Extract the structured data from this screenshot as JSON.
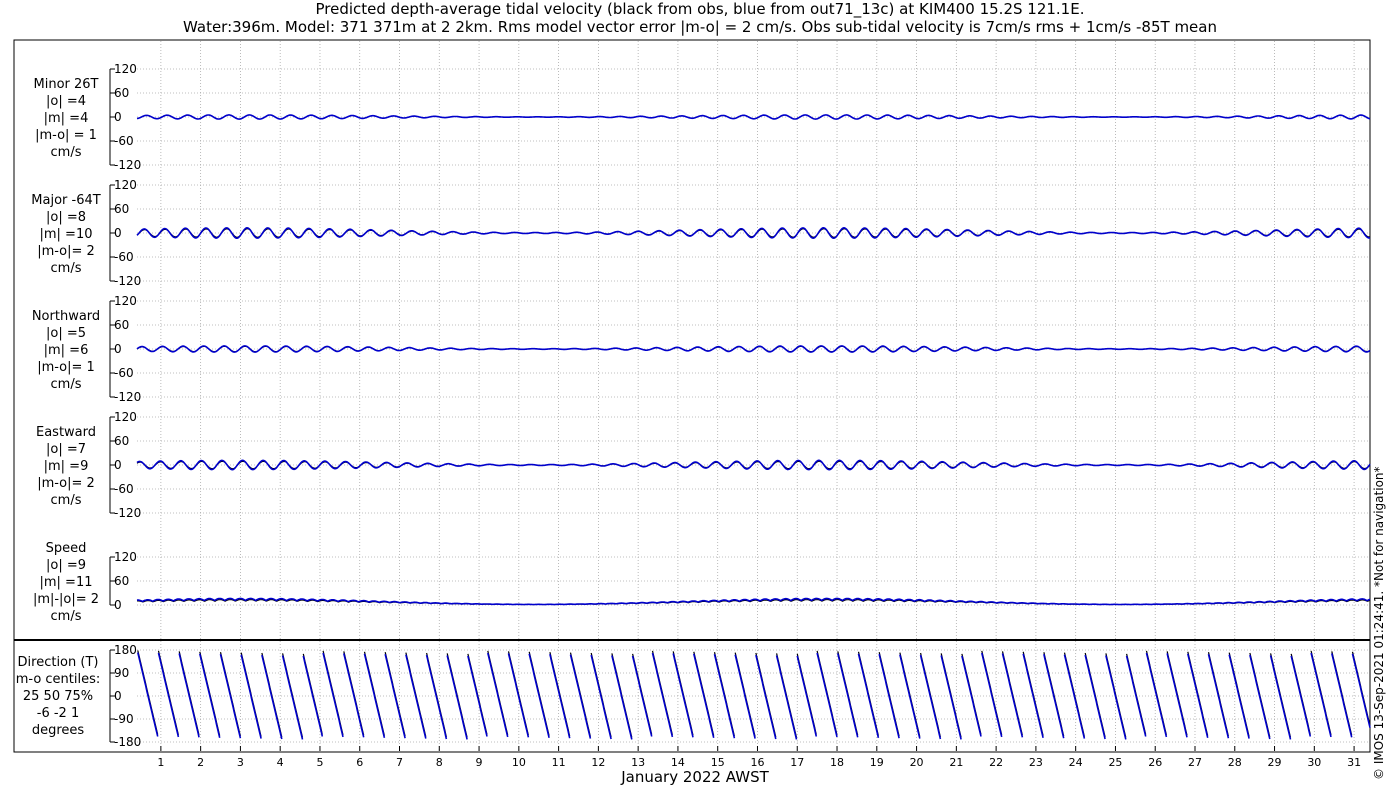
{
  "title_line1": "Predicted depth-average tidal velocity (black from obs, blue from out71_13c) at KIM400 15.2S 121.1E.",
  "title_line2": "Water:396m. Model: 371 371m at 2 2km. Rms model vector error |m-o| = 2 cm/s. Obs sub-tidal velocity is 7cm/s rms + 1cm/s -85T mean",
  "credit": "© IMOS 13-Sep-2021 01:24:41. *Not for navigation*",
  "colors": {
    "obs": "#000000",
    "model": "#0000cc",
    "grid": "#aaaaaa"
  },
  "chart_data": {
    "type": "line",
    "xlabel": "January 2022 AWST",
    "x_ticks": [
      "1",
      "2",
      "3",
      "4",
      "5",
      "6",
      "7",
      "8",
      "9",
      "10",
      "11",
      "12",
      "13",
      "14",
      "15",
      "16",
      "17",
      "18",
      "19",
      "20",
      "21",
      "22",
      "23",
      "24",
      "25",
      "26",
      "27",
      "28",
      "29",
      "30",
      "31"
    ],
    "xlim": [
      0.4,
      31.4
    ],
    "grid": true,
    "series_colors_meaning": [
      "black from obs",
      "blue from out71_13c"
    ],
    "panels": [
      {
        "label": [
          "Minor 26T",
          "|o| =4",
          "|m| =4",
          "|m-o| = 1",
          "cm/s"
        ],
        "ylim": [
          -120,
          120
        ],
        "yticks": [
          "120",
          "60",
          "0",
          "-60",
          "-120"
        ],
        "amplitude_obs": 4,
        "amplitude_model": 4
      },
      {
        "label": [
          "Major -64T",
          "|o| =8",
          "|m| =10",
          "|m-o|= 2",
          "cm/s"
        ],
        "ylim": [
          -120,
          120
        ],
        "yticks": [
          "120",
          "60",
          "0",
          "-60",
          "-120"
        ],
        "amplitude_obs": 8,
        "amplitude_model": 10
      },
      {
        "label": [
          "Northward",
          "|o| =5",
          "|m| =6",
          "|m-o|= 1",
          "cm/s"
        ],
        "ylim": [
          -120,
          120
        ],
        "yticks": [
          "120",
          "60",
          "0",
          "-60",
          "-120"
        ],
        "amplitude_obs": 5,
        "amplitude_model": 6
      },
      {
        "label": [
          "Eastward",
          "|o| =7",
          "|m| =9",
          "|m-o|= 2",
          "cm/s"
        ],
        "ylim": [
          -120,
          120
        ],
        "yticks": [
          "120",
          "60",
          "0",
          "-60",
          "-120"
        ],
        "amplitude_obs": 7,
        "amplitude_model": 9
      },
      {
        "label": [
          "Speed",
          "|o| =9",
          "|m| =11",
          "|m|-|o|= 2",
          "cm/s"
        ],
        "ylim": [
          0,
          120
        ],
        "yticks": [
          "120",
          "60",
          "0"
        ],
        "amplitude_obs": 9,
        "amplitude_model": 11
      },
      {
        "label": [
          "Direction (T)",
          "m-o centiles:",
          "25  50  75%",
          "-6 -2  1",
          "degrees"
        ],
        "ylim": [
          -180,
          180
        ],
        "yticks": [
          "180",
          "90",
          "0",
          "-90",
          "-180"
        ],
        "type": "direction"
      }
    ]
  }
}
